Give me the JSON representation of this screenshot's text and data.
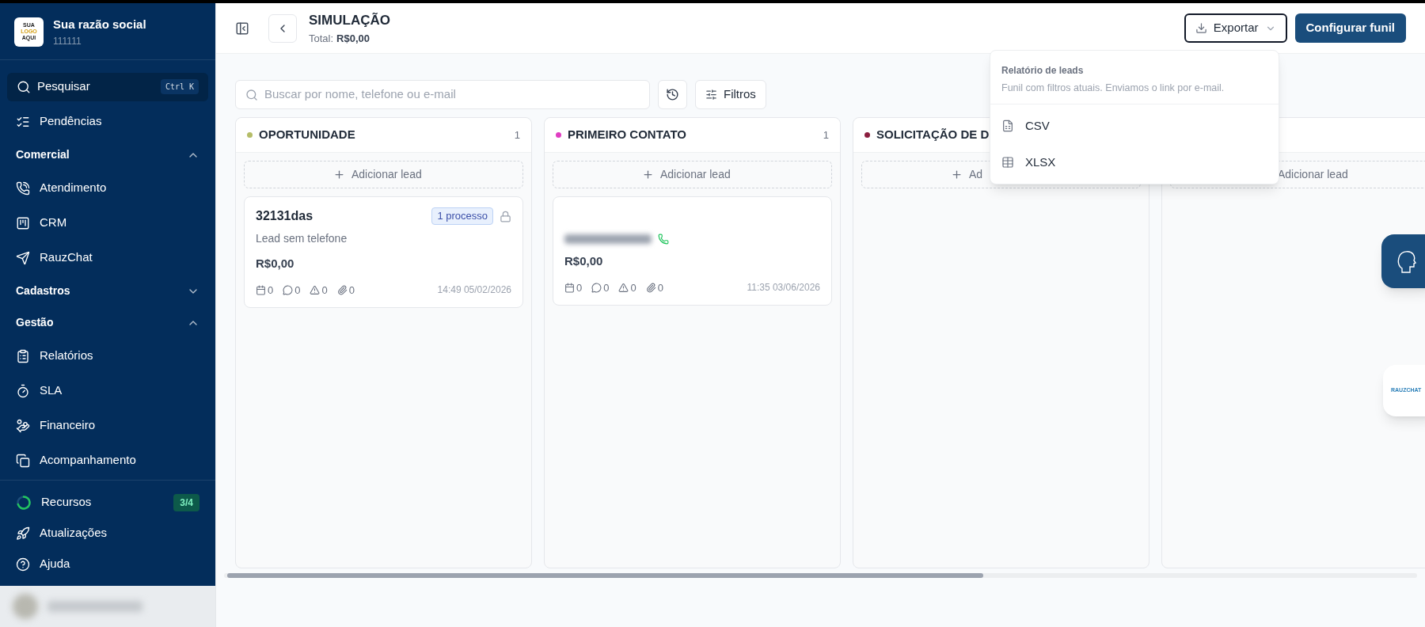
{
  "company": {
    "logo_text": [
      "SUA",
      "LOGO",
      "AQUI"
    ],
    "name": "Sua razão social",
    "code": "111111"
  },
  "search": {
    "label": "Pesquisar",
    "shortcut": [
      "Ctrl",
      "K"
    ]
  },
  "nav": [
    {
      "kind": "item",
      "label": "Pendências"
    },
    {
      "kind": "section",
      "label": "Comercial",
      "expanded": true
    },
    {
      "kind": "item",
      "label": "Atendimento"
    },
    {
      "kind": "item",
      "label": "CRM"
    },
    {
      "kind": "item",
      "label": "RauzChat"
    },
    {
      "kind": "section",
      "label": "Cadastros",
      "expanded": false
    },
    {
      "kind": "section",
      "label": "Gestão",
      "expanded": true
    },
    {
      "kind": "item",
      "label": "Relatórios"
    },
    {
      "kind": "item",
      "label": "SLA"
    },
    {
      "kind": "item",
      "label": "Financeiro"
    },
    {
      "kind": "item",
      "label": "Acompanhamento"
    }
  ],
  "footer": [
    {
      "label": "Recursos",
      "badge": "3/4"
    },
    {
      "label": "Atualizações"
    },
    {
      "label": "Ajuda"
    }
  ],
  "header": {
    "title": "SIMULAÇÃO",
    "total_label": "Total:",
    "total": "R$0,00",
    "export": "Exportar",
    "configure": "Configurar funil"
  },
  "toolbar": {
    "placeholder": "Buscar por nome, telefone ou e-mail",
    "filters": "Filtros"
  },
  "columns": [
    {
      "title": "OPORTUNIDADE",
      "count": "1",
      "color": "#b5bd68",
      "add": "Adicionar lead",
      "cards": [
        {
          "name": "32131das",
          "badge": "1 processo",
          "locked": true,
          "subtitle": "Lead sem telefone",
          "value": "R$0,00",
          "counts": [
            "0",
            "0",
            "0",
            "0"
          ],
          "time": "14:49 05/02/2026"
        }
      ]
    },
    {
      "title": "PRIMEIRO CONTATO",
      "count": "1",
      "color": "#e03ec2",
      "add": "Adicionar lead",
      "cards": [
        {
          "blurred": true,
          "whatsapp": true,
          "value": "R$0,00",
          "counts": [
            "0",
            "0",
            "0",
            "0"
          ],
          "time": "11:35 03/06/2026"
        }
      ]
    },
    {
      "title": "SOLICITAÇÃO DE D",
      "color": "#8b1e3f",
      "add": "Ad"
    },
    {
      "add": "Adicionar lead"
    }
  ],
  "export_menu": {
    "title": "Relatório de leads",
    "description": "Funil com filtros atuais. Enviamos o link por e-mail.",
    "options": [
      {
        "label": "CSV"
      },
      {
        "label": "XLSX"
      }
    ]
  },
  "widget": {
    "label": "RAUZCHAT"
  }
}
